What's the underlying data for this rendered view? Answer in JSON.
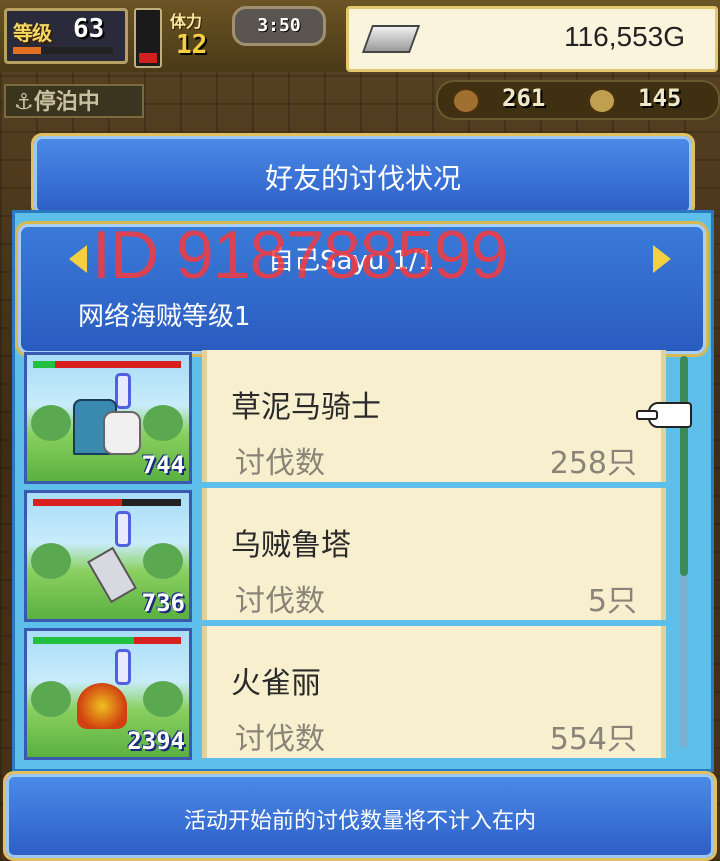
{
  "hud": {
    "level_label": "等级",
    "level_value": "63",
    "level_progress": 0.28,
    "stamina_bar_fill": 0.2,
    "stamina_label": "体力",
    "stamina_value": "12",
    "clock": "3:50",
    "gold": "116,553G",
    "status": "停泊中",
    "resource1_value": "261",
    "resource2_value": "145"
  },
  "dialog": {
    "title": "好友的讨伐状况",
    "player_name": "自己Sayu 1/1",
    "watermark": "ID 918788599",
    "pirate_level": "网络海贼等级1",
    "footer_note": "活动开始前的讨伐数量将不计入在内",
    "entries": [
      {
        "name": "草泥马骑士",
        "kill_label": "讨伐数",
        "kills": "258只",
        "monster_number": "744",
        "hp_level": 0.15,
        "hp_color": "#22c040",
        "hp2_color": "#d82020"
      },
      {
        "name": "乌贼鲁塔",
        "kill_label": "讨伐数",
        "kills": "5只",
        "monster_number": "736",
        "hp_level": 0.6,
        "hp_color": "#d82020",
        "hp2_color": "#222222"
      },
      {
        "name": "火雀丽",
        "kill_label": "讨伐数",
        "kills": "554只",
        "monster_number": "2394",
        "hp_level": 0.68,
        "hp_color": "#22c040",
        "hp2_color": "#d82020"
      }
    ]
  },
  "colors": {
    "panel_blue": "#2e5fc8",
    "card_bg": "#f8efcf",
    "accent_gold": "#f4d040"
  }
}
